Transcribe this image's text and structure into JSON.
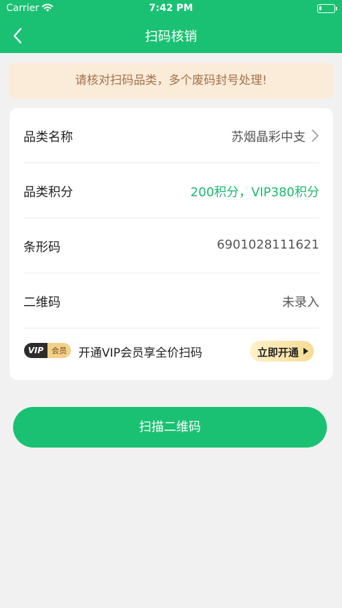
{
  "status_bar": {
    "carrier": "Carrier",
    "time": "7:42 PM"
  },
  "nav": {
    "title": "扫码核销"
  },
  "notice": {
    "text": "请核对扫码品类，多个废码封号处理!"
  },
  "details": [
    {
      "label": "品类名称",
      "value": "苏烟晶彩中支"
    },
    {
      "label": "品类积分",
      "value": "200积分，VIP380积分"
    },
    {
      "label": "条形码",
      "value": "6901028111621"
    },
    {
      "label": "二维码",
      "value": "未录入"
    }
  ],
  "vip": {
    "badge_left": "VIP",
    "badge_right": "会员",
    "promo_text": "开通VIP会员享全价扫码",
    "button_label": "立即开通"
  },
  "scan_button": {
    "label": "扫描二维码"
  },
  "colors": {
    "primary": "#1ac173",
    "accent_text": "#1ab96c",
    "notice_bg": "#fbebd9",
    "notice_text": "#a2714a"
  }
}
